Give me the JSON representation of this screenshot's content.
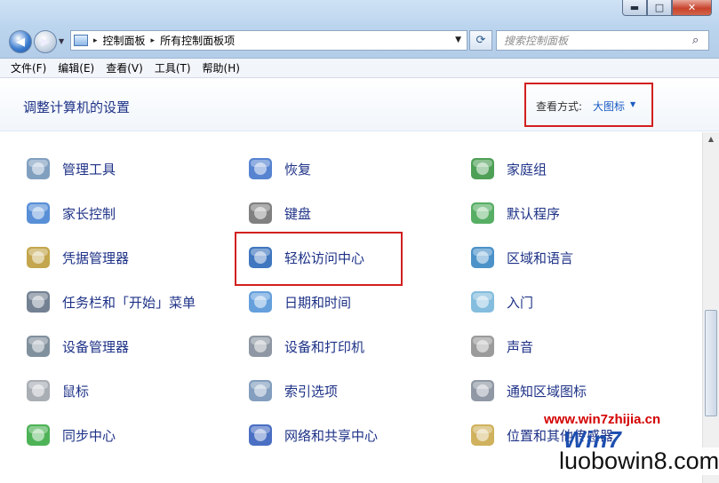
{
  "window_buttons": {
    "minimize": "▬",
    "maximize": "□",
    "close": "✕"
  },
  "nav": {
    "back": "◀",
    "forward": "▶",
    "recent": "▼"
  },
  "address": {
    "crumbs": [
      "控制面板",
      "所有控制面板项"
    ],
    "separator": "▸",
    "dropdown": "▼"
  },
  "refresh_glyph": "⟳",
  "search": {
    "placeholder": "搜索控制面板",
    "glyph": "⌕"
  },
  "menu": [
    "文件(F)",
    "编辑(E)",
    "查看(V)",
    "工具(T)",
    "帮助(H)"
  ],
  "header": {
    "title": "调整计算机的设置",
    "view_label": "查看方式:",
    "view_value": "大图标",
    "view_arrow": "▼"
  },
  "items": [
    {
      "label": "管理工具",
      "icon": "admin-tools-icon",
      "color": "#6b8fb5"
    },
    {
      "label": "恢复",
      "icon": "recovery-icon",
      "color": "#3a6fc9"
    },
    {
      "label": "家庭组",
      "icon": "homegroup-icon",
      "color": "#2f8f3a"
    },
    {
      "label": "家长控制",
      "icon": "parental-controls-icon",
      "color": "#3b7bd0"
    },
    {
      "label": "键盘",
      "icon": "keyboard-icon",
      "color": "#6a6a6a"
    },
    {
      "label": "默认程序",
      "icon": "default-programs-icon",
      "color": "#3aa04a"
    },
    {
      "label": "凭据管理器",
      "icon": "credential-manager-icon",
      "color": "#b8962e"
    },
    {
      "label": "轻松访问中心",
      "icon": "ease-of-access-icon",
      "color": "#1f5fb4"
    },
    {
      "label": "区域和语言",
      "icon": "region-language-icon",
      "color": "#2d7fc0"
    },
    {
      "label": "任务栏和「开始」菜单",
      "icon": "taskbar-icon",
      "color": "#5a6b80"
    },
    {
      "label": "日期和时间",
      "icon": "date-time-icon",
      "color": "#4a8fd6"
    },
    {
      "label": "入门",
      "icon": "getting-started-icon",
      "color": "#6fb2d8"
    },
    {
      "label": "设备管理器",
      "icon": "device-manager-icon",
      "color": "#6b7c8c"
    },
    {
      "label": "设备和打印机",
      "icon": "devices-printers-icon",
      "color": "#7a8593"
    },
    {
      "label": "声音",
      "icon": "sound-icon",
      "color": "#8a8a8a"
    },
    {
      "label": "鼠标",
      "icon": "mouse-icon",
      "color": "#9aa0a8"
    },
    {
      "label": "索引选项",
      "icon": "indexing-options-icon",
      "color": "#6d8db3"
    },
    {
      "label": "通知区域图标",
      "icon": "notification-area-icon",
      "color": "#7b8694"
    },
    {
      "label": "同步中心",
      "icon": "sync-center-icon",
      "color": "#2fa63a"
    },
    {
      "label": "网络和共享中心",
      "icon": "network-sharing-icon",
      "color": "#2a56b8"
    },
    {
      "label": "位置和其他传感器",
      "icon": "location-sensors-icon",
      "color": "#c8a542"
    }
  ],
  "watermark": {
    "url": "www.win7zhijia.cn",
    "brand": "Win7",
    "domain": "luobowin8.com"
  },
  "scroll": {
    "up": "▲"
  }
}
